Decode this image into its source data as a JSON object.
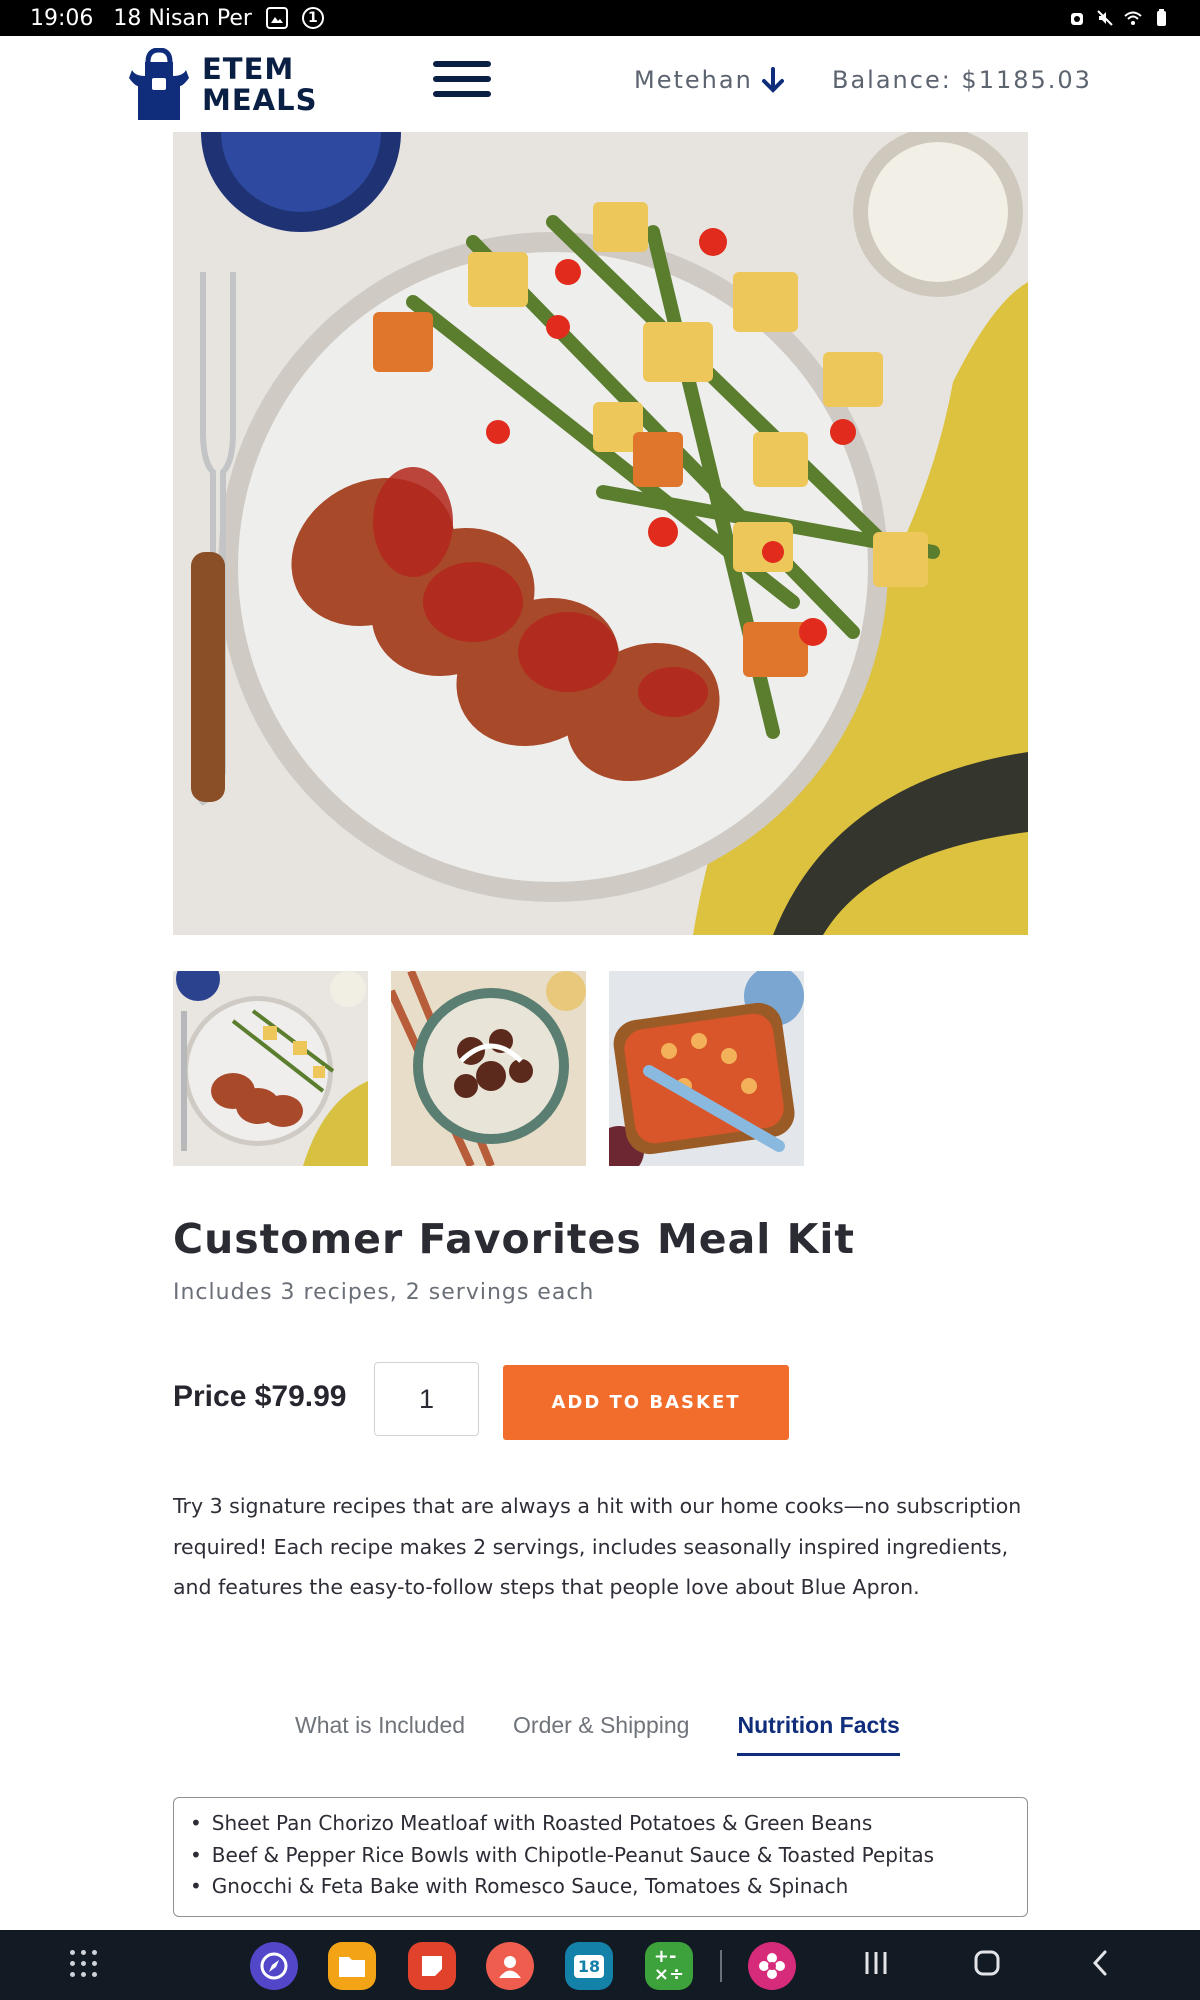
{
  "status_bar": {
    "time": "19:06",
    "date": "18 Nisan Per",
    "notification_icons": [
      "gallery-icon",
      "badge-icon"
    ],
    "system_icons": [
      "alarm-icon",
      "mute-icon",
      "wifi-icon",
      "battery-icon"
    ]
  },
  "header": {
    "logo_line1": "ETEM",
    "logo_line2": "MEALS",
    "user_name": "Metehan",
    "balance": "Balance: $1185.03"
  },
  "product": {
    "title": "Customer Favorites Meal Kit",
    "subtitle": "Includes 3 recipes, 2 servings each",
    "price": "Price $79.99",
    "quantity": "1",
    "add_button": "ADD TO BASKET",
    "description": "Try 3 signature recipes that are always a hit with our home cooks—no subscription required! Each recipe makes 2 servings, includes seasonally inspired ingredients, and features the easy-to-follow steps that people love about Blue Apron."
  },
  "tabs": [
    {
      "label": "What is Included",
      "active": false
    },
    {
      "label": "Order & Shipping",
      "active": false
    },
    {
      "label": "Nutrition Facts",
      "active": true
    }
  ],
  "included_items": [
    "Sheet Pan Chorizo Meatloaf with Roasted Potatoes & Green Beans",
    "Beef & Pepper Rice Bowls with Chipotle-Peanut Sauce & Toasted Pepitas",
    "Gnocchi & Feta Bake with Romesco Sauce, Tomatoes & Spinach"
  ],
  "colors": {
    "brand_navy": "#0a1f44",
    "accent_orange": "#f26c2b",
    "active_tab": "#0f2d7b"
  },
  "nav_apps": [
    "browser-icon",
    "files-icon",
    "notes-icon",
    "contacts-icon",
    "calendar-icon",
    "calculator-icon",
    "gallery-flower-icon"
  ],
  "nav_calendar_day": "18"
}
